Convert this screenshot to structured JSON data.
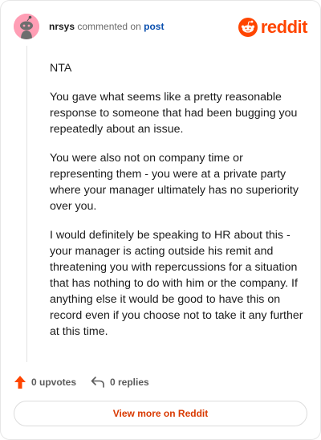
{
  "comment": {
    "author": "nrsys",
    "action_text": "commented on",
    "target_text": "post",
    "paragraphs": [
      "NTA",
      "You gave what seems like a pretty reasonable response to someone that had been bugging you repeatedly about an issue.",
      "You were also not on company time or representing them - you were at a private party where your manager ultimately has no superiority over you.",
      "I would definitely be speaking to HR about this - your manager is acting outside his remit and threatening you with repercussions for a situation that has nothing to do with him or the company. If anything else it would be good to have this on record even if you choose not to take it any further at this time."
    ]
  },
  "brand": {
    "wordmark": "reddit",
    "color": "#ff4500"
  },
  "actions": {
    "upvotes_label": "0 upvotes",
    "replies_label": "0 replies"
  },
  "footer": {
    "view_more_label": "View more on Reddit"
  },
  "icons": {
    "avatar": "snoo-avatar",
    "brand": "reddit-logo-icon",
    "upvote": "upvote-arrow-icon",
    "reply": "reply-arrow-icon"
  }
}
